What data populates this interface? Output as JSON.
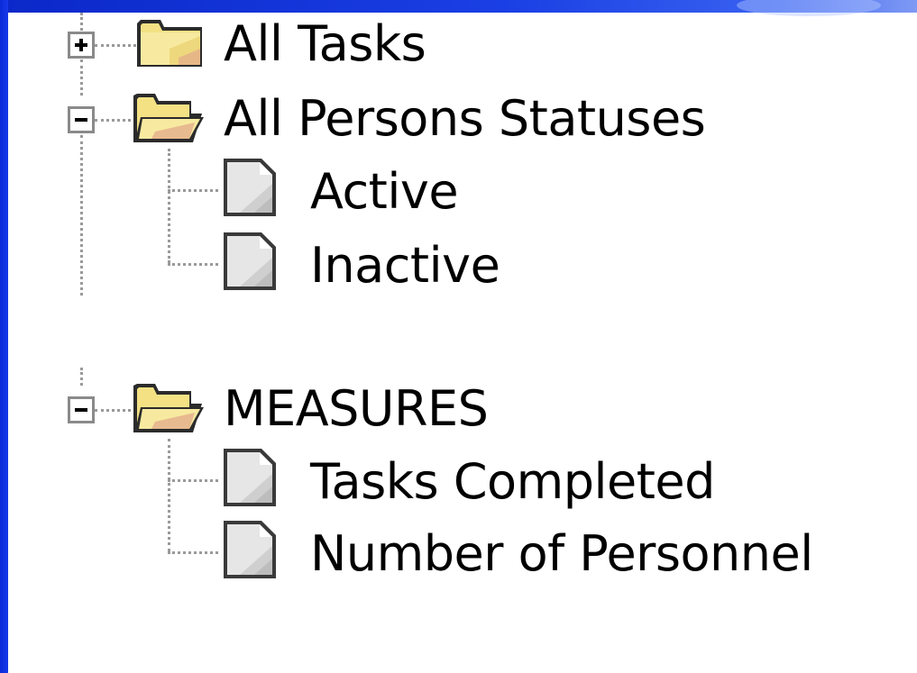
{
  "tree": {
    "nodes": [
      {
        "id": "all-tasks",
        "label": "All Tasks",
        "kind": "folder",
        "expander": "+",
        "state": "collapsed"
      },
      {
        "id": "all-persons-statuses",
        "label": "All Persons Statuses",
        "kind": "folder",
        "expander": "−",
        "state": "expanded",
        "children": [
          {
            "id": "active",
            "label": "Active",
            "kind": "document"
          },
          {
            "id": "inactive",
            "label": "Inactive",
            "kind": "document"
          }
        ]
      },
      {
        "id": "measures",
        "label": "MEASURES",
        "kind": "folder",
        "expander": "−",
        "state": "expanded",
        "children": [
          {
            "id": "tasks-completed",
            "label": "Tasks Completed",
            "kind": "document"
          },
          {
            "id": "number-of-personnel",
            "label": "Number of Personnel",
            "kind": "document"
          }
        ]
      }
    ],
    "icons": {
      "folder_closed": "folder-icon",
      "folder_open": "folder-open-icon",
      "document": "document-icon"
    },
    "colors": {
      "frame_blue": "#1433e0",
      "folder_yellow": "#f6e58a",
      "tree_line": "#9a9a9a"
    }
  }
}
